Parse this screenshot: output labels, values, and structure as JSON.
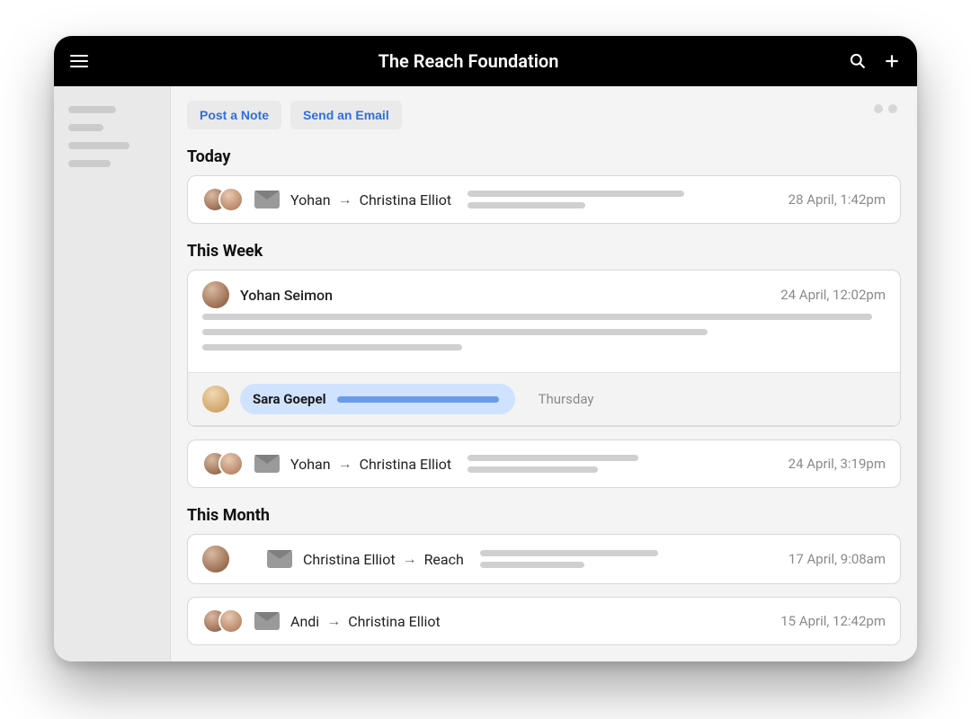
{
  "header": {
    "title": "The Reach Foundation"
  },
  "actions": {
    "post_note": "Post a Note",
    "send_email": "Send an Email"
  },
  "sections": {
    "today": "Today",
    "this_week": "This Week",
    "this_month": "This Month"
  },
  "today_item": {
    "from": "Yohan",
    "to": "Christina Elliot",
    "arrow": "→",
    "time": "28 April, 1:42pm"
  },
  "week_note": {
    "author": "Yohan Seimon",
    "time": "24 April, 12:02pm"
  },
  "week_reply": {
    "author": "Sara Goepel",
    "time": "Thursday"
  },
  "week_email": {
    "from": "Yohan",
    "to": "Christina Elliot",
    "arrow": "→",
    "time": "24 April, 3:19pm"
  },
  "month_item1": {
    "from": "Christina Elliot",
    "to": "Reach",
    "arrow": "→",
    "time": "17 April, 9:08am"
  },
  "month_item2": {
    "from": "Andi",
    "to": "Christina Elliot",
    "arrow": "→",
    "time": "15 April, 12:42pm"
  }
}
